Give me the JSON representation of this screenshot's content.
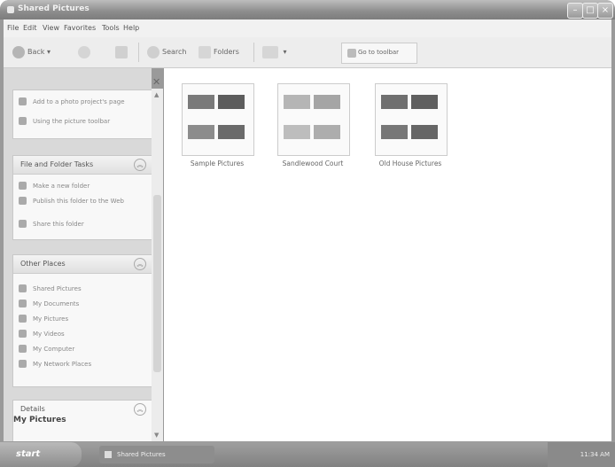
{
  "window": {
    "title": "Shared Pictures"
  },
  "menu": [
    "File",
    "Edit",
    "View",
    "Favorites",
    "Tools",
    "Help"
  ],
  "toolbar": {
    "back": "Back",
    "search": "Search",
    "folders": "Folders",
    "address": "Go to toolbar"
  },
  "picture_tasks": {
    "items": [
      "Add to a photo project's page",
      "Using the picture toolbar"
    ]
  },
  "file_folder_tasks": {
    "title": "File and Folder Tasks",
    "items": [
      "Make a new folder",
      "Publish this folder to the Web",
      "Share this folder"
    ]
  },
  "other_places": {
    "title": "Other Places",
    "items": [
      "Shared Pictures",
      "My Documents",
      "My Pictures",
      "My Videos",
      "My Computer",
      "My Network Places"
    ]
  },
  "details": {
    "title": "Details",
    "name": "My Pictures"
  },
  "folders": [
    {
      "label": "Sample Pictures"
    },
    {
      "label": "Sandlewood Court"
    },
    {
      "label": "Old House Pictures"
    }
  ],
  "taskbar": {
    "start": "start",
    "task": "Shared Pictures",
    "clock": "11:34 AM"
  }
}
